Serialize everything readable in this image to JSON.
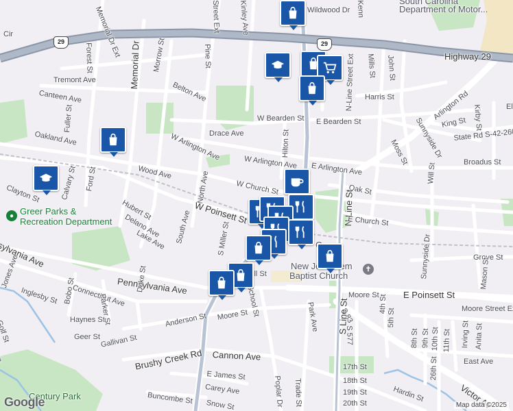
{
  "map": {
    "attribution": "Map data ©2025",
    "logo": "Google",
    "highway_label": "Highway 29",
    "shield_number": "29"
  },
  "pois": {
    "parks_dept_line1": "Greer Parks &",
    "parks_dept_line2": "Recreation Department",
    "church_line1": "New Jerusalem",
    "church_line2": "Baptist Church",
    "century_park": "Century Park",
    "sc_dept_line1": "South Carolina",
    "sc_dept_line2": "Department of Motor...",
    "greer_label": "Greer"
  },
  "streets": [
    {
      "id": "wildwood-dr",
      "text": "Wildwood Dr"
    },
    {
      "id": "memorial-dr-ext-top",
      "text": "Memorial Dr Ext"
    },
    {
      "id": "memorial-dr",
      "text": "Memorial Dr"
    },
    {
      "id": "street-ext",
      "text": "Street Ext"
    },
    {
      "id": "kinley-ave",
      "text": "Kinley Ave"
    },
    {
      "id": "forest-st",
      "text": "Forest St"
    },
    {
      "id": "morrow-st",
      "text": "Morrow St"
    },
    {
      "id": "pine-st",
      "text": "Pine St"
    },
    {
      "id": "tremont-ave",
      "text": "Tremont Ave"
    },
    {
      "id": "belton-ave",
      "text": "Belton Ave"
    },
    {
      "id": "canteen-ave",
      "text": "Canteen Ave"
    },
    {
      "id": "fuller-st",
      "text": "Fuller St"
    },
    {
      "id": "oakland-ave",
      "text": "Oakland Ave"
    },
    {
      "id": "drace-ave",
      "text": "Drace Ave"
    },
    {
      "id": "w-bearden-st",
      "text": "W Bearden St"
    },
    {
      "id": "e-bearden-st",
      "text": "E Bearden St"
    },
    {
      "id": "w-arlington-ave-1",
      "text": "W Arlington Ave"
    },
    {
      "id": "w-arlington-ave-2",
      "text": "W Arlington Ave"
    },
    {
      "id": "e-arlington-ave",
      "text": "E Arlington Ave"
    },
    {
      "id": "hilton-st",
      "text": "Hilton St"
    },
    {
      "id": "mills-st",
      "text": "Mills St"
    },
    {
      "id": "john-st",
      "text": "John St"
    },
    {
      "id": "n-line-street-ext",
      "text": "N-Line Street Ext"
    },
    {
      "id": "harris-st",
      "text": "Harris St"
    },
    {
      "id": "arlington-rd",
      "text": "Arlington Rd"
    },
    {
      "id": "highway-29",
      "text": "Highway 29"
    },
    {
      "id": "kirby-st",
      "text": "Kirby St"
    },
    {
      "id": "king-st",
      "text": "King St"
    },
    {
      "id": "state-rd",
      "text": "State Rd S-42-260"
    },
    {
      "id": "sunnyside-dr-1",
      "text": "Sunnyside Dr"
    },
    {
      "id": "moss-st",
      "text": "Moss St"
    },
    {
      "id": "broadus-st",
      "text": "Broadus St"
    },
    {
      "id": "wood-ave",
      "text": "Wood Ave"
    },
    {
      "id": "north-ave",
      "text": "North Ave"
    },
    {
      "id": "ford-st",
      "text": "Ford St"
    },
    {
      "id": "calvary-st",
      "text": "Calvary St"
    },
    {
      "id": "clayton-st",
      "text": "Clayton St"
    },
    {
      "id": "w-church-st",
      "text": "W Church St"
    },
    {
      "id": "w-poinsett-st",
      "text": "W Poinsett St"
    },
    {
      "id": "oak-st",
      "text": "Oak St"
    },
    {
      "id": "n-line-st",
      "text": "N Line St"
    },
    {
      "id": "will-st",
      "text": "Will St"
    },
    {
      "id": "e-church-st",
      "text": "E Church St"
    },
    {
      "id": "hubert-st",
      "text": "Hubert St"
    },
    {
      "id": "delano-ave",
      "text": "Delano Ave"
    },
    {
      "id": "south-ave",
      "text": "South Ave"
    },
    {
      "id": "lake-ave",
      "text": "Lake Ave"
    },
    {
      "id": "s-miller-st",
      "text": "S Miller St"
    },
    {
      "id": "sylvania-ave",
      "text": "sylvania Ave"
    },
    {
      "id": "grove-st",
      "text": "Grove St"
    },
    {
      "id": "sunnyside-dr-2",
      "text": "Sunnyside Dr"
    },
    {
      "id": "mason-st",
      "text": "Mason St"
    },
    {
      "id": "pennsylvania-ave",
      "text": "Pennsylvania Ave"
    },
    {
      "id": "hill-st",
      "text": "ill St"
    },
    {
      "id": "jones-ave",
      "text": "Jones Ave"
    },
    {
      "id": "inglesby-st",
      "text": "Inglesby St"
    },
    {
      "id": "bobo-st",
      "text": "Bobo St"
    },
    {
      "id": "connecticut-ave",
      "text": "Connecticut Ave"
    },
    {
      "id": "school-st",
      "text": "School St"
    },
    {
      "id": "moore-st-e",
      "text": "Moore St"
    },
    {
      "id": "e-poinsett-st",
      "text": "E Poinsett St"
    },
    {
      "id": "haynes-st",
      "text": "Haynes St"
    },
    {
      "id": "parker-st",
      "text": "Parker St"
    },
    {
      "id": "duke-st",
      "text": "Duke St"
    },
    {
      "id": "s-83",
      "text": "S 83"
    },
    {
      "id": "4th-st",
      "text": "4th St"
    },
    {
      "id": "5th-st",
      "text": "5th St"
    },
    {
      "id": "moore-street-ext",
      "text": "Moore Street Ext"
    },
    {
      "id": "golf-st",
      "text": "Golf St"
    },
    {
      "id": "geer-st",
      "text": "Geer St"
    },
    {
      "id": "anderson-st",
      "text": "Anderson St"
    },
    {
      "id": "moore-st-w",
      "text": "Moore St"
    },
    {
      "id": "park-ave",
      "text": "Park Ave"
    },
    {
      "id": "gallivan-st",
      "text": "Gallivan St"
    },
    {
      "id": "s-line-st",
      "text": "S Line St"
    },
    {
      "id": "s-577",
      "text": "S 577"
    },
    {
      "id": "8th-st",
      "text": "8th St"
    },
    {
      "id": "9th-st",
      "text": "9th St"
    },
    {
      "id": "10th-st",
      "text": "10th St"
    },
    {
      "id": "11th-st",
      "text": "11th St"
    },
    {
      "id": "irving-st",
      "text": "Irving St"
    },
    {
      "id": "anita-st",
      "text": "Anita St"
    },
    {
      "id": "brushy-creek-rd",
      "text": "Brushy Creek Rd"
    },
    {
      "id": "cannon-ave",
      "text": "Cannon Ave"
    },
    {
      "id": "east-ave",
      "text": "East Ave"
    },
    {
      "id": "17th-st",
      "text": "17th St"
    },
    {
      "id": "e-james-st",
      "text": "E James St"
    },
    {
      "id": "18th-st",
      "text": "18th St"
    },
    {
      "id": "carey-ave",
      "text": "Carey Ave"
    },
    {
      "id": "poplar-dr",
      "text": "Poplar Dr"
    },
    {
      "id": "trade-st",
      "text": "Trade St"
    },
    {
      "id": "19th-st",
      "text": "19th St"
    },
    {
      "id": "buncombe-st",
      "text": "Buncombe St"
    },
    {
      "id": "20th-st",
      "text": "20th St"
    },
    {
      "id": "snow-st",
      "text": "Snow St"
    },
    {
      "id": "hardin-st",
      "text": "Hardin St"
    },
    {
      "id": "26th-st",
      "text": "26th St"
    },
    {
      "id": "victor-ave",
      "text": "Victor Av"
    },
    {
      "id": "kenn",
      "text": "Kenn"
    },
    {
      "id": "cir",
      "text": "Cir"
    },
    {
      "id": "ell",
      "text": "Ell"
    },
    {
      "id": "ton",
      "text": "ton"
    }
  ],
  "markers": [
    {
      "id": "shopping-1",
      "icon": "shopping-bag-icon"
    },
    {
      "id": "school-1",
      "icon": "school-icon"
    },
    {
      "id": "shopping-2",
      "icon": "shopping-bag-icon"
    },
    {
      "id": "cart-1",
      "icon": "shopping-cart-icon"
    },
    {
      "id": "shopping-3",
      "icon": "shopping-bag-icon"
    },
    {
      "id": "shopping-4",
      "icon": "shopping-bag-icon"
    },
    {
      "id": "school-2",
      "icon": "school-icon"
    },
    {
      "id": "cafe-1",
      "icon": "coffee-cup-icon"
    },
    {
      "id": "restaurant-1",
      "icon": "restaurant-icon"
    },
    {
      "id": "restaurant-2",
      "icon": "restaurant-icon"
    },
    {
      "id": "restaurant-3",
      "icon": "restaurant-icon"
    },
    {
      "id": "shopping-5",
      "icon": "shopping-bag-icon"
    },
    {
      "id": "shopping-6",
      "icon": "shopping-bag-icon"
    },
    {
      "id": "shopping-7",
      "icon": "shopping-bag-icon"
    },
    {
      "id": "shopping-8",
      "icon": "shopping-bag-icon"
    }
  ]
}
